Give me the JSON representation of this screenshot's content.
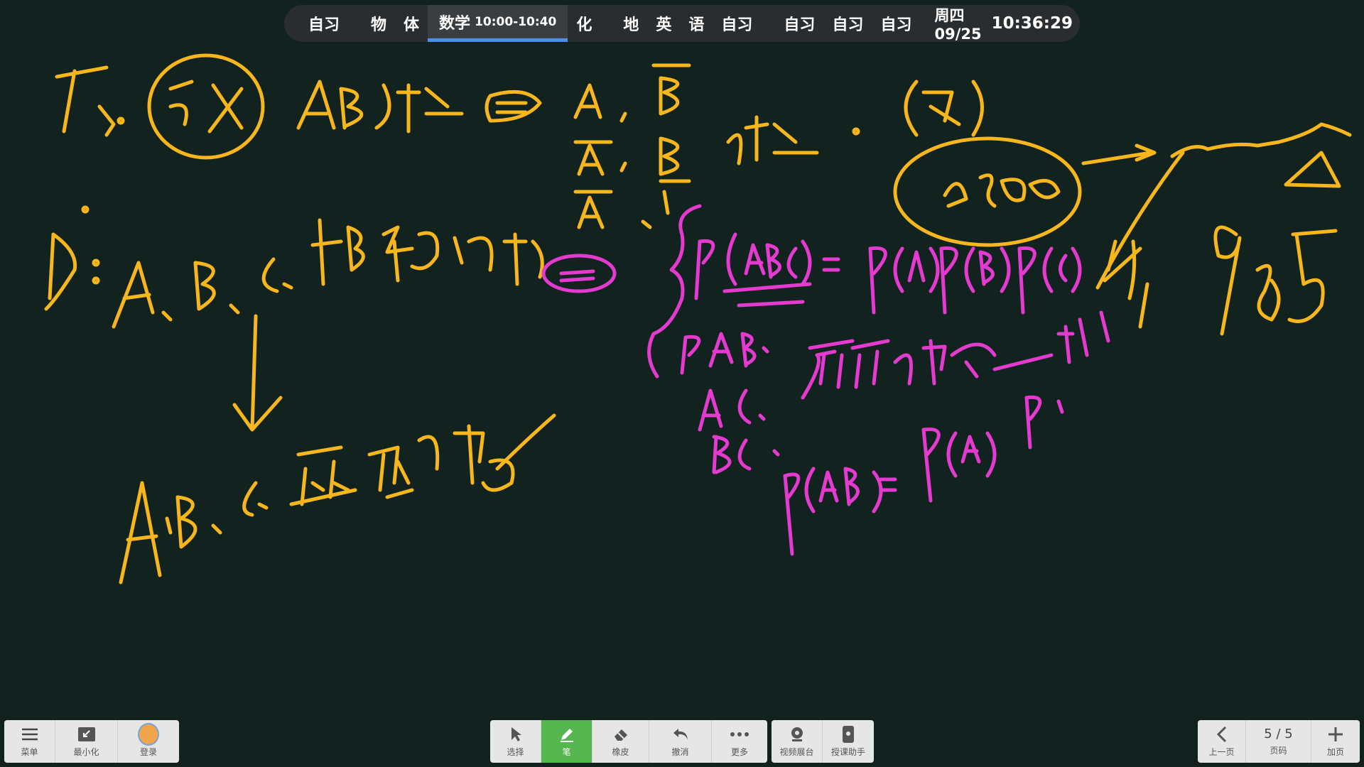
{
  "schedule": {
    "slots": [
      "自习",
      "物",
      "体",
      "数学",
      "化",
      "地",
      "英",
      "语",
      "自习",
      "自习",
      "自习",
      "自习"
    ],
    "current_time": "10:00-10:40",
    "weekday_date": "周四 09/25",
    "clock": "10:36:29"
  },
  "toolbar_left": {
    "menu": "菜单",
    "minimize": "最小化",
    "login": "登录"
  },
  "toolbar_center": {
    "select": "选择",
    "pen": "笔",
    "eraser": "橡皮",
    "undo": "撤消",
    "more": "更多"
  },
  "toolbar_extra": {
    "video_booth": "视频展台",
    "teaching_assistant": "授课助手"
  },
  "toolbar_right": {
    "prev": "上一页",
    "page_indicator": "5 / 5",
    "page_label": "页码",
    "add_page": "加页"
  },
  "colors": {
    "ink_yellow": "#f7b71c",
    "ink_magenta": "#e43ad0",
    "board": "#12221e",
    "active_tool": "#56b64f"
  }
}
